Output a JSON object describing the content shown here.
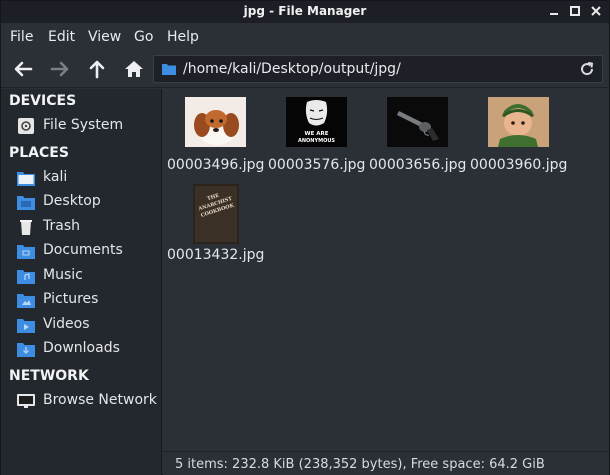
{
  "window": {
    "title": "jpg - File Manager",
    "controls": [
      "minimize",
      "maximize",
      "close"
    ]
  },
  "menu": {
    "file": "File",
    "edit": "Edit",
    "view": "View",
    "go": "Go",
    "help": "Help"
  },
  "toolbar": {
    "back_icon": "left-arrow-icon",
    "forward_icon": "right-arrow-icon",
    "up_icon": "up-arrow-icon",
    "home_icon": "home-icon",
    "path": "/home/kali/Desktop/output/jpg/",
    "reload_icon": "reload-icon"
  },
  "sidebar": {
    "devices_header": "DEVICES",
    "devices": [
      {
        "label": "File System",
        "icon": "drive-icon"
      }
    ],
    "places_header": "PLACES",
    "places": [
      {
        "label": "kali",
        "icon": "home-folder-icon"
      },
      {
        "label": "Desktop",
        "icon": "desktop-folder-icon"
      },
      {
        "label": "Trash",
        "icon": "trash-icon"
      },
      {
        "label": "Documents",
        "icon": "documents-folder-icon"
      },
      {
        "label": "Music",
        "icon": "music-folder-icon"
      },
      {
        "label": "Pictures",
        "icon": "pictures-folder-icon"
      },
      {
        "label": "Videos",
        "icon": "videos-folder-icon"
      },
      {
        "label": "Downloads",
        "icon": "downloads-folder-icon"
      }
    ],
    "network_header": "NETWORK",
    "network": [
      {
        "label": "Browse Network",
        "icon": "network-icon"
      }
    ]
  },
  "files": [
    {
      "name": "00003496.jpg",
      "thumb": "puppy"
    },
    {
      "name": "00003576.jpg",
      "thumb": "anonymous",
      "thumb_text_1": "WE ARE",
      "thumb_text_2": "ANONYMOUS"
    },
    {
      "name": "00003656.jpg",
      "thumb": "revolver"
    },
    {
      "name": "00003960.jpg",
      "thumb": "child-with-cap"
    },
    {
      "name": "00013432.jpg",
      "thumb": "book-cover",
      "thumb_text_1": "THE",
      "thumb_text_2": "ANARCHIST",
      "thumb_text_3": "COOKBOOK"
    }
  ],
  "status": {
    "text": "5 items: 232.8 KiB (238,352 bytes), Free space: 64.2 GiB"
  },
  "colors": {
    "window_bg": "#2b2f36",
    "sidebar_bg": "#23272e",
    "titlebar_bg": "#1c1f25",
    "folder_blue": "#3d8de3"
  }
}
